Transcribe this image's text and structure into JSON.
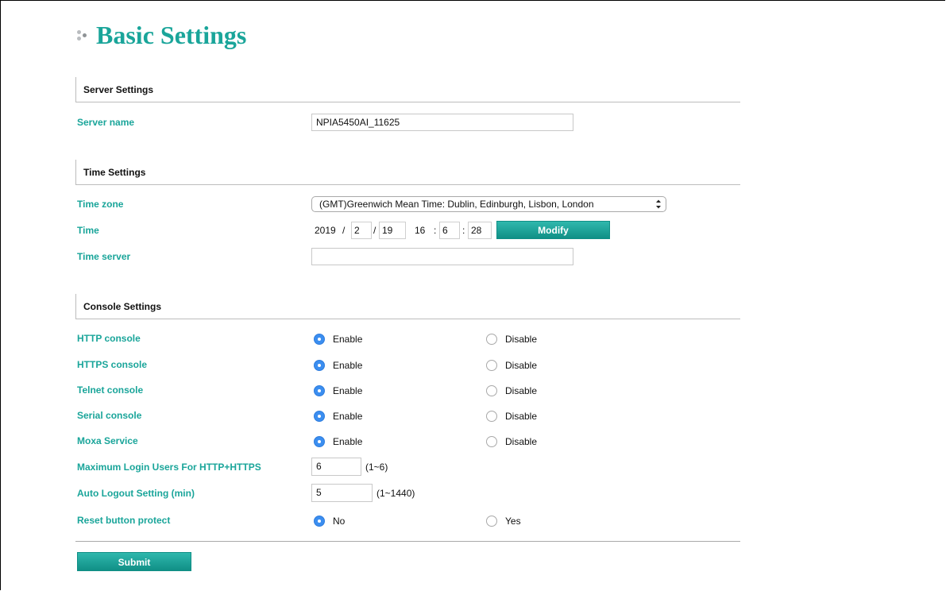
{
  "colors": {
    "accent": "#1aa59a",
    "button_gradient_top": "#2fb8ad",
    "button_gradient_bottom": "#108f86",
    "radio_selected": "#3b8ef0"
  },
  "page": {
    "title": "Basic Settings",
    "title_icon": "dots-bullet-icon"
  },
  "sections": {
    "server": "Server Settings",
    "time": "Time Settings",
    "console": "Console Settings"
  },
  "server": {
    "name_label": "Server name",
    "name_value": "NPIA5450AI_11625"
  },
  "time": {
    "zone_label": "Time zone",
    "zone_value": "(GMT)Greenwich Mean Time: Dublin, Edinburgh, Lisbon, London",
    "time_label": "Time",
    "year": "2019",
    "month": "2",
    "day": "19",
    "hour": "16",
    "minute": "6",
    "second": "28",
    "date_sep": "/",
    "time_sep": ":",
    "modify_label": "Modify",
    "server_label": "Time server",
    "server_value": ""
  },
  "console": {
    "enable_label": "Enable",
    "disable_label": "Disable",
    "rows": [
      {
        "label": "HTTP console",
        "selected": "enable"
      },
      {
        "label": "HTTPS console",
        "selected": "enable"
      },
      {
        "label": "Telnet console",
        "selected": "enable"
      },
      {
        "label": "Serial console",
        "selected": "enable"
      },
      {
        "label": "Moxa Service",
        "selected": "enable"
      }
    ],
    "max_login_label": "Maximum Login Users For HTTP+HTTPS",
    "max_login_value": "6",
    "max_login_hint": "(1~6)",
    "auto_logout_label": "Auto Logout Setting (min)",
    "auto_logout_value": "5",
    "auto_logout_hint": "(1~1440)",
    "reset_label": "Reset button protect",
    "reset_no": "No",
    "reset_yes": "Yes",
    "reset_selected": "no"
  },
  "actions": {
    "submit_label": "Submit"
  }
}
